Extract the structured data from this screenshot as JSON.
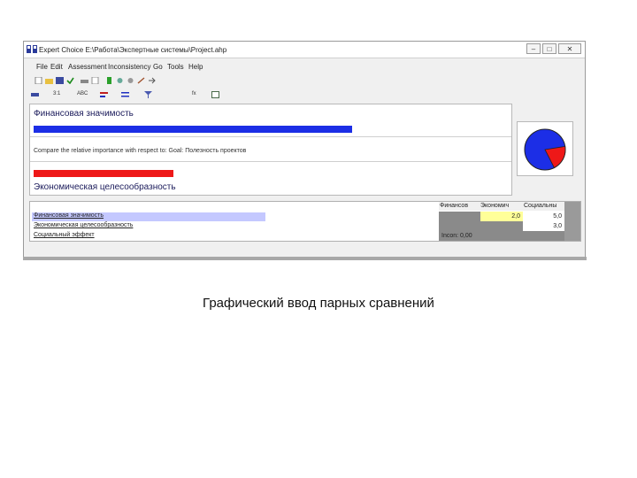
{
  "window": {
    "title": "Expert Choice    E:\\Работа\\Экспертные системы\\Project.ahp",
    "controls": {
      "minimize": "–",
      "maximize": "□",
      "close": "✕"
    }
  },
  "menu": [
    "File",
    "Edit",
    "Assessment",
    "Inconsistency",
    "Go",
    "Tools",
    "Help"
  ],
  "toolbar": {
    "label_3to1": "3:1",
    "label_abc": "ABC",
    "label_fx": "fx"
  },
  "comparison": {
    "top_label": "Финансовая значимость",
    "prompt": "Compare the relative importance with respect to: Goal: Полезность проектов",
    "bottom_label": "Экономическая целесообразность",
    "top_value": 0.75,
    "bottom_value": 0.33
  },
  "grid": {
    "columns": [
      "Финансов",
      "Экономич",
      "Социальны"
    ],
    "rows": [
      {
        "label": "Финансовая значимость",
        "bar_value": 0.44,
        "values": [
          "",
          "2,0",
          "5,0"
        ]
      },
      {
        "label": "Экономическая целесообразность",
        "values": [
          "",
          "",
          "3,0"
        ]
      },
      {
        "label": "Социальный эффект",
        "values": [
          "",
          "",
          ""
        ]
      }
    ],
    "inconsistency": "Incon: 0,00"
  },
  "pie": {
    "blue_share": 0.8
  },
  "colors": {
    "blue": "#1c2ee6",
    "red": "#ee1818",
    "highlight": "#ffff99",
    "row_highlight": "#c4c8ff",
    "grid_gray": "#8a8a8a"
  },
  "caption": "Графический ввод парных сравнений"
}
